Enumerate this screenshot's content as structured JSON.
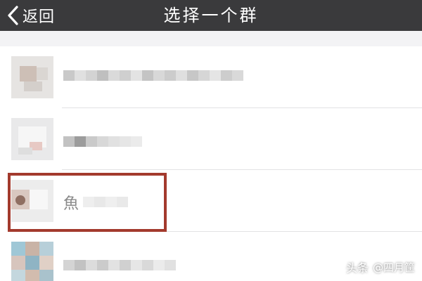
{
  "header": {
    "back_label": "返回",
    "title": "选择一个群"
  },
  "groups": [
    {
      "name": "",
      "blurred": true
    },
    {
      "name": "",
      "blurred": true
    },
    {
      "name": "魚",
      "blurred": true,
      "highlighted": true
    },
    {
      "name": "",
      "blurred": true
    }
  ],
  "watermark": {
    "platform": "头条",
    "author": "@四月筐"
  },
  "colors": {
    "titlebar": "#3a3a3c",
    "highlight_border": "#a33a2d",
    "list_background": "#f3f3f5"
  }
}
